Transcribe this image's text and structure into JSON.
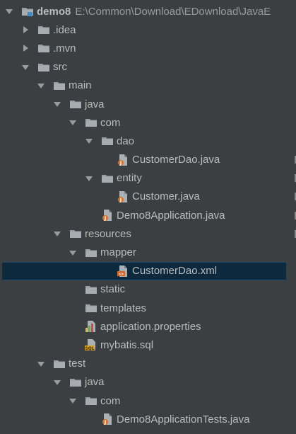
{
  "tree": {
    "root": {
      "label": "demo8",
      "path": "E:\\Common\\Download\\EDownload\\JavaE"
    },
    "items": [
      {
        "label": ".idea"
      },
      {
        "label": ".mvn"
      },
      {
        "label": "src"
      },
      {
        "label": "main"
      },
      {
        "label": "java"
      },
      {
        "label": "com"
      },
      {
        "label": "dao"
      },
      {
        "label": "CustomerDao.java"
      },
      {
        "label": "entity"
      },
      {
        "label": "Customer.java"
      },
      {
        "label": "Demo8Application.java"
      },
      {
        "label": "resources"
      },
      {
        "label": "mapper"
      },
      {
        "label": "CustomerDao.xml"
      },
      {
        "label": "static"
      },
      {
        "label": "templates"
      },
      {
        "label": "application.properties"
      },
      {
        "label": "mybatis.sql"
      },
      {
        "label": "test"
      },
      {
        "label": "java"
      },
      {
        "label": "com"
      },
      {
        "label": "Demo8ApplicationTests.java"
      }
    ]
  }
}
